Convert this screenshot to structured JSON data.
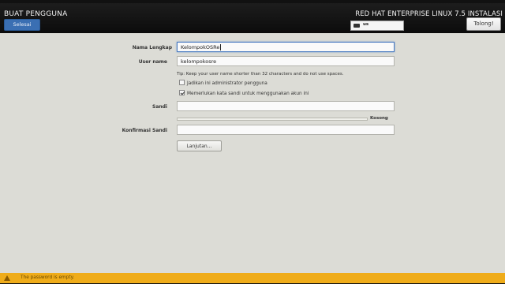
{
  "header": {
    "title": "BUAT PENGGUNA",
    "done_label": "Selesai",
    "product": "RED HAT ENTERPRISE LINUX 7.5 INSTALASI",
    "keyboard_layout": "us",
    "help_label": "Tolong!"
  },
  "form": {
    "fullname_label": "Nama Lengkap",
    "fullname_value": "KelompokOSRe",
    "username_label": "User name",
    "username_value": "kelompokosre",
    "tip": "Tip: Keep your user name shorter than 32 characters and do not use spaces.",
    "admin_checkbox_label": "Jadikan ini administrator pengguna",
    "admin_checked": false,
    "require_password_label": "Memerlukan kata sandi untuk menggunakan akun ini",
    "require_password_checked": true,
    "password_label": "Sandi",
    "password_value": "",
    "strength_label": "Kosong",
    "strength_fraction": 0,
    "confirm_label": "Konfirmasi Sandi",
    "confirm_value": "",
    "advanced_label": "Lanjutan..."
  },
  "status": {
    "message": "The password is empty.",
    "icon": "warning-icon",
    "color": "#efac1a"
  }
}
